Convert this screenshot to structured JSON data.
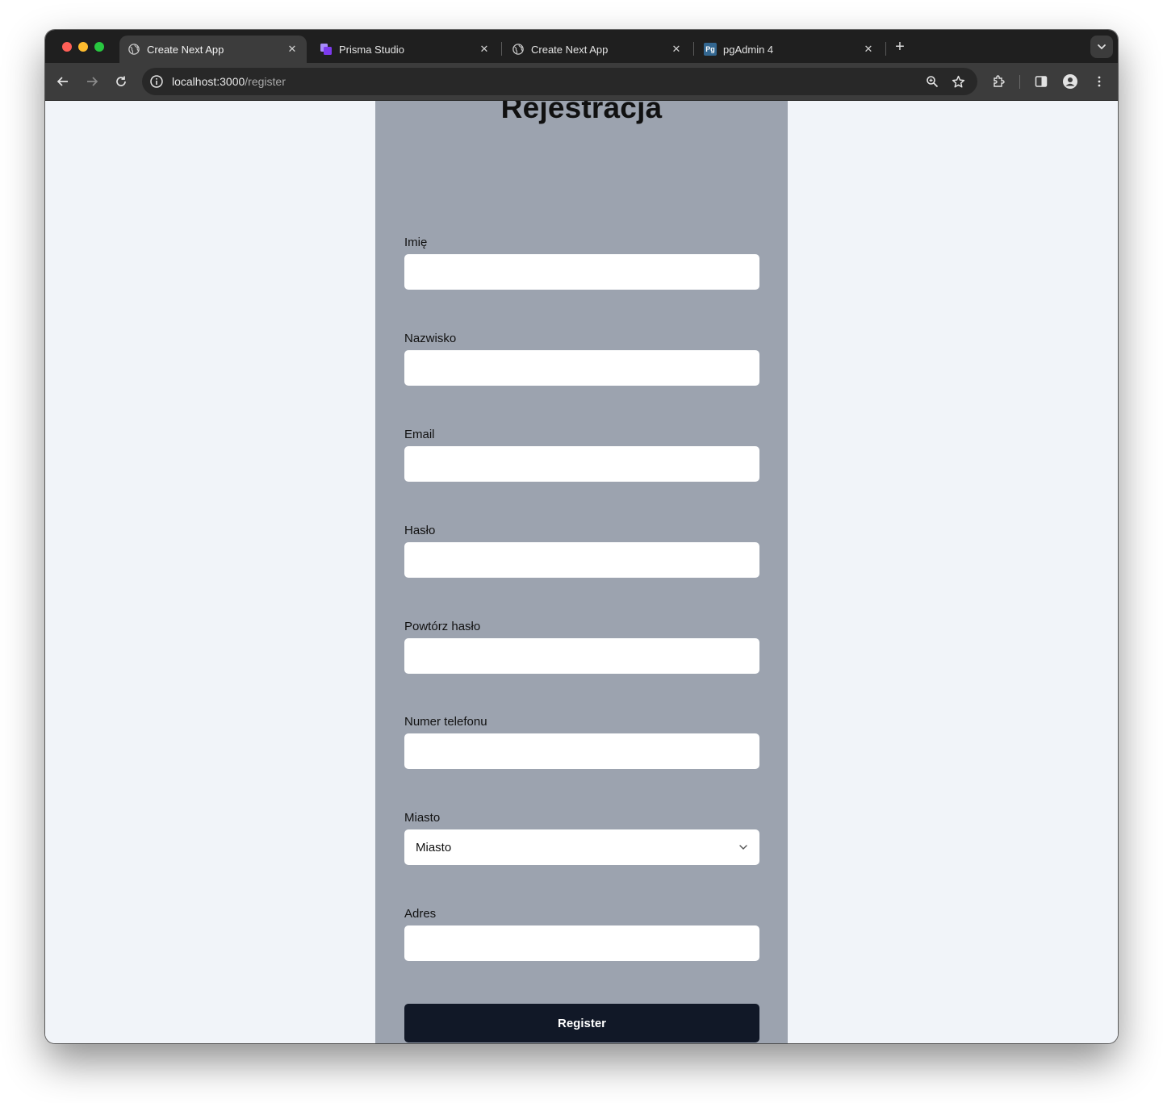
{
  "browser": {
    "tabs": [
      {
        "title": "Create Next App",
        "favicon": "globe-icon",
        "active": true
      },
      {
        "title": "Prisma Studio",
        "favicon": "prisma-icon",
        "active": false
      },
      {
        "title": "Create Next App",
        "favicon": "globe-icon",
        "active": false
      },
      {
        "title": "pgAdmin 4",
        "favicon": "pgadmin-icon",
        "favicon_text": "Pg",
        "active": false
      }
    ],
    "address": {
      "host": "localhost:3000",
      "path": "/register"
    }
  },
  "page": {
    "title": "Rejestracja",
    "fields": [
      {
        "label": "Imię",
        "value": ""
      },
      {
        "label": "Nazwisko",
        "value": ""
      },
      {
        "label": "Email",
        "value": ""
      },
      {
        "label": "Hasło",
        "value": ""
      },
      {
        "label": "Powtórz hasło",
        "value": ""
      },
      {
        "label": "Numer telefonu",
        "value": ""
      },
      {
        "label": "Miasto",
        "selected": "Miasto"
      },
      {
        "label": "Adres",
        "value": ""
      }
    ],
    "submit_label": "Register"
  },
  "colors": {
    "page_background": "#f1f4f9",
    "card_background": "#9ca3af",
    "button_background": "#111827",
    "chrome_dark": "#1f1f1f",
    "chrome_toolbar": "#3c3c3c"
  }
}
